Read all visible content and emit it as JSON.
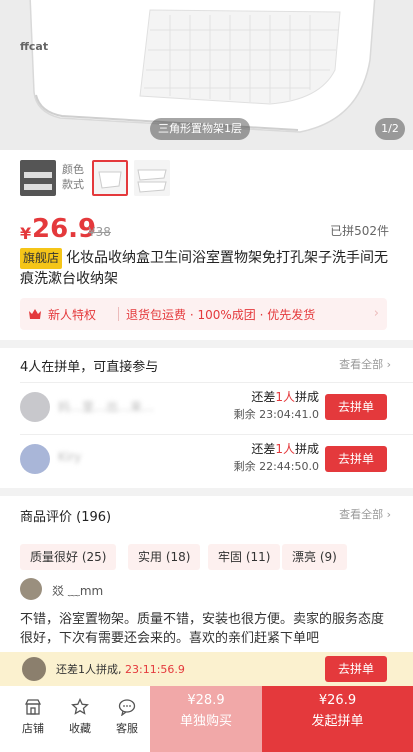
{
  "product_image": {
    "brand": "ffcat",
    "caption": "三角形置物架1层",
    "index": "1/2"
  },
  "sku": {
    "label": "颜色款式"
  },
  "price": {
    "currency": "¥",
    "current": "26.9",
    "original": "¥38",
    "sold": "已拼502件"
  },
  "title": {
    "badge": "旗舰店",
    "text": "化妆品收纳盒卫生间浴室置物架免打孔架子洗手间无痕洗漱台收纳架"
  },
  "promo": {
    "new_user": "新人特权",
    "text": "退货包运费 · 100%成团 · 优先发货",
    "arrow": "›"
  },
  "group_buy": {
    "title": "4人在拼单，可直接参与",
    "see_all": "查看全部",
    "rows": [
      {
        "name": "妈…里…出…来…",
        "need_prefix": "还差",
        "need_count": "1人",
        "need_suffix": "拼成",
        "remaining": "剩余 23:04:41.0",
        "button": "去拼单"
      },
      {
        "name": "Kiry",
        "need_prefix": "还差",
        "need_count": "1人",
        "need_suffix": "拼成",
        "remaining": "剩余 22:44:50.0",
        "button": "去拼单"
      }
    ]
  },
  "reviews": {
    "title": "商品评价 (196)",
    "see_all": "查看全部",
    "tags": [
      "质量很好 (25)",
      "实用 (18)",
      "牢固 (11)",
      "漂亮 (9)"
    ],
    "reviewer": "㸚 ﹏mm",
    "text": "不错，浴室置物架。质量不错，安装也很方便。卖家的服务态度很好，下次有需要还会来的。喜欢的亲们赶紧下单吧"
  },
  "floating": {
    "text": "还差1人拼成,",
    "time": "23:11:56.9",
    "button": "去拼单"
  },
  "bottom_bar": {
    "shop": "店铺",
    "favorite": "收藏",
    "service": "客服",
    "alone_price": "¥28.9",
    "alone_label": "单独购买",
    "group_price": "¥26.9",
    "group_label": "发起拼单"
  },
  "colors": {
    "accent": "#e4393c",
    "badge": "#f5c518"
  }
}
